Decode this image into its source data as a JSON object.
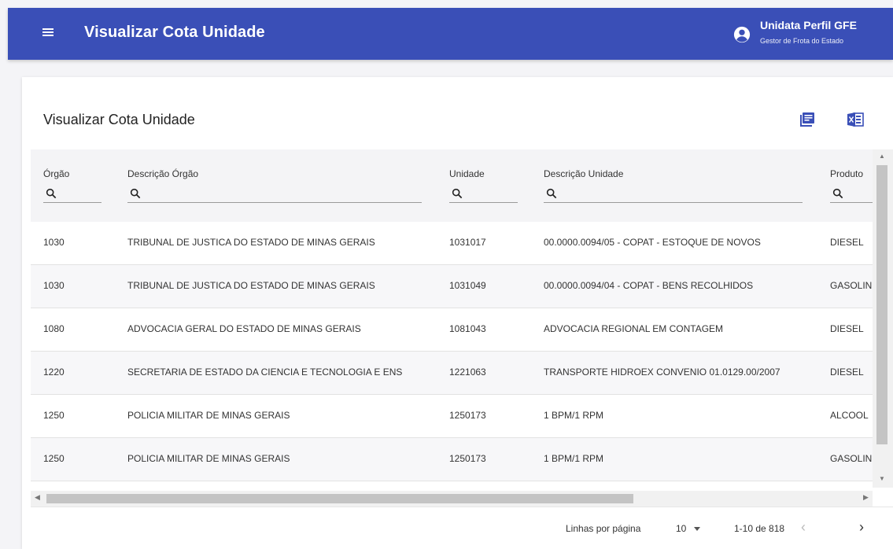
{
  "app": {
    "title": "Visualizar Cota Unidade"
  },
  "user": {
    "name": "Unidata Perfil GFE",
    "role": "Gestor de Frota do Estado"
  },
  "card": {
    "title": "Visualizar Cota Unidade"
  },
  "icons": {
    "menu": "menu-icon",
    "user": "account-circle-icon",
    "pdf": "pdf-export-icon",
    "excel": "excel-export-icon",
    "search": "search-icon"
  },
  "colors": {
    "primary": "#3a4fb7",
    "text": "#2b2b2b"
  },
  "table": {
    "columns": [
      "Órgão",
      "Descrição Órgão",
      "Unidade",
      "Descrição Unidade",
      "Produto"
    ],
    "rows": [
      [
        "1030",
        "TRIBUNAL DE JUSTICA DO ESTADO DE MINAS GERAIS",
        "1031017",
        "00.0000.0094/05 - COPAT - ESTOQUE DE NOVOS",
        "DIESEL"
      ],
      [
        "1030",
        "TRIBUNAL DE JUSTICA DO ESTADO DE MINAS GERAIS",
        "1031049",
        "00.0000.0094/04 - COPAT - BENS RECOLHIDOS",
        "GASOLIN"
      ],
      [
        "1080",
        "ADVOCACIA GERAL DO ESTADO DE MINAS GERAIS",
        "1081043",
        "ADVOCACIA REGIONAL EM CONTAGEM",
        "DIESEL"
      ],
      [
        "1220",
        "SECRETARIA DE ESTADO DA CIENCIA E TECNOLOGIA E ENS",
        "1221063",
        "TRANSPORTE HIDROEX CONVENIO 01.0129.00/2007",
        "DIESEL"
      ],
      [
        "1250",
        "POLICIA MILITAR DE MINAS GERAIS",
        "1250173",
        "1 BPM/1 RPM",
        "ALCOOL"
      ],
      [
        "1250",
        "POLICIA MILITAR DE MINAS GERAIS",
        "1250173",
        "1 BPM/1 RPM",
        "GASOLIN"
      ]
    ]
  },
  "pagination": {
    "rows_label": "Linhas por página",
    "rows_value": "10",
    "range": "1-10 de 818"
  }
}
